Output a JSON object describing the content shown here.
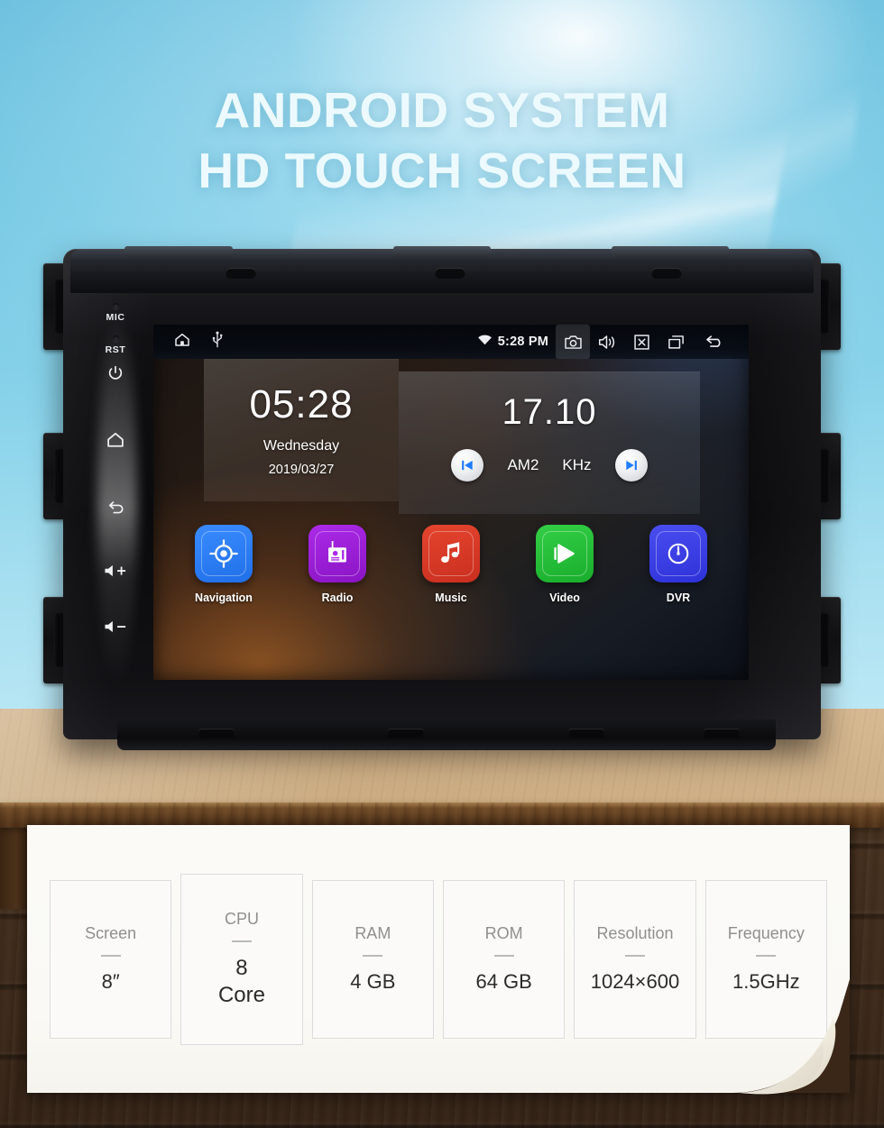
{
  "headline": {
    "line1": "ANDROID SYSTEM",
    "line2": "HD TOUCH SCREEN"
  },
  "device": {
    "side_keys": [
      {
        "name": "mic",
        "label": "MIC"
      },
      {
        "name": "reset",
        "label": "RST"
      },
      {
        "name": "power",
        "label": ""
      },
      {
        "name": "home",
        "label": ""
      },
      {
        "name": "back",
        "label": ""
      },
      {
        "name": "volume-up",
        "label": ""
      },
      {
        "name": "volume-down",
        "label": ""
      }
    ],
    "screen": {
      "statusbar": {
        "left_icons": [
          "home-icon",
          "usb-icon"
        ],
        "wifi_icon": "wifi-icon",
        "time": "5:28 PM",
        "right_icons": [
          "camera-icon",
          "volume-icon",
          "close-icon",
          "recents-icon",
          "back-icon"
        ]
      },
      "clock_widget": {
        "time": "05:28",
        "weekday": "Wednesday",
        "date": "2019/03/27"
      },
      "radio_widget": {
        "frequency": "17.10",
        "band": "AM2",
        "unit": "KHz",
        "prev_label": "prev-station",
        "next_label": "next-station"
      },
      "apps": [
        {
          "label": "Navigation",
          "icon": "navigation-icon",
          "color": "#2b7cf0"
        },
        {
          "label": "Radio",
          "icon": "radio-icon",
          "color": "#9b1fd6"
        },
        {
          "label": "Music",
          "icon": "music-icon",
          "color": "#d93a27"
        },
        {
          "label": "Video",
          "icon": "video-icon",
          "color": "#25bf3a"
        },
        {
          "label": "DVR",
          "icon": "dvr-icon",
          "color": "#3b3fe0"
        }
      ]
    }
  },
  "specs": {
    "cards": [
      {
        "key": "Screen",
        "value": "8″",
        "big": false
      },
      {
        "key": "CPU",
        "value": "8\nCore",
        "big": true
      },
      {
        "key": "RAM",
        "value": "4 GB",
        "big": false
      },
      {
        "key": "ROM",
        "value": "64 GB",
        "big": false
      },
      {
        "key": "Resolution",
        "value": "1024×600",
        "big": false
      },
      {
        "key": "Frequency",
        "value": "1.5GHz",
        "big": false
      }
    ]
  },
  "colors": {
    "sky": "#72c7e3",
    "headline_text": "#ecfaff",
    "wood_light": "#d2b48c",
    "wood_dark": "#3a2718",
    "paper": "#fbfaf7",
    "card_border": "#dcdcdc",
    "card_key": "#8f8f8f",
    "card_value": "#2b2b2b",
    "accent_blue": "#1f7bff"
  }
}
